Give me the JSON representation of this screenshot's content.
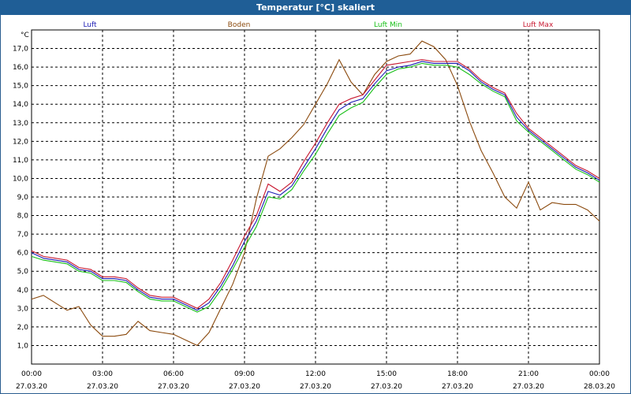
{
  "window": {
    "title": "Temperatur [°C] skaliert"
  },
  "chart_data": {
    "type": "line",
    "title": "Temperatur [°C] skaliert",
    "ylabel": "°C",
    "ylim": [
      0,
      18
    ],
    "xlim_hours": [
      0,
      24
    ],
    "grid": true,
    "legend_placement": "top",
    "y_ticks": [
      "1,0",
      "2,0",
      "3,0",
      "4,0",
      "5,0",
      "6,0",
      "7,0",
      "8,0",
      "9,0",
      "10,0",
      "11,0",
      "12,0",
      "13,0",
      "14,0",
      "15,0",
      "16,0",
      "17,0"
    ],
    "x_ticks": [
      {
        "time": "00:00",
        "date": "27.03.20"
      },
      {
        "time": "03:00",
        "date": "27.03.20"
      },
      {
        "time": "06:00",
        "date": "27.03.20"
      },
      {
        "time": "09:00",
        "date": "27.03.20"
      },
      {
        "time": "12:00",
        "date": "27.03.20"
      },
      {
        "time": "15:00",
        "date": "27.03.20"
      },
      {
        "time": "18:00",
        "date": "27.03.20"
      },
      {
        "time": "21:00",
        "date": "27.03.20"
      },
      {
        "time": "00:00",
        "date": "28.03.20"
      }
    ],
    "series": [
      {
        "name": "Luft",
        "color": "#1a1ab4",
        "points": [
          [
            "00:00",
            6.0
          ],
          [
            "00:30",
            5.7
          ],
          [
            "01:00",
            5.6
          ],
          [
            "01:30",
            5.5
          ],
          [
            "02:00",
            5.1
          ],
          [
            "02:30",
            5.0
          ],
          [
            "03:00",
            4.6
          ],
          [
            "03:30",
            4.6
          ],
          [
            "04:00",
            4.5
          ],
          [
            "04:30",
            4.0
          ],
          [
            "05:00",
            3.6
          ],
          [
            "05:30",
            3.5
          ],
          [
            "06:00",
            3.5
          ],
          [
            "06:30",
            3.2
          ],
          [
            "07:00",
            2.9
          ],
          [
            "07:30",
            3.3
          ],
          [
            "08:00",
            4.2
          ],
          [
            "08:30",
            5.3
          ],
          [
            "09:00",
            6.6
          ],
          [
            "09:30",
            7.7
          ],
          [
            "10:00",
            9.3
          ],
          [
            "10:30",
            9.1
          ],
          [
            "11:00",
            9.6
          ],
          [
            "11:30",
            10.6
          ],
          [
            "12:00",
            11.6
          ],
          [
            "12:30",
            12.7
          ],
          [
            "13:00",
            13.7
          ],
          [
            "13:30",
            14.1
          ],
          [
            "14:00",
            14.3
          ],
          [
            "14:30",
            15.1
          ],
          [
            "15:00",
            15.8
          ],
          [
            "15:30",
            16.0
          ],
          [
            "16:00",
            16.1
          ],
          [
            "16:30",
            16.3
          ],
          [
            "17:00",
            16.2
          ],
          [
            "17:30",
            16.2
          ],
          [
            "18:00",
            16.2
          ],
          [
            "18:30",
            15.8
          ],
          [
            "19:00",
            15.2
          ],
          [
            "19:30",
            14.8
          ],
          [
            "20:00",
            14.5
          ],
          [
            "20:30",
            13.3
          ],
          [
            "21:00",
            12.6
          ],
          [
            "21:30",
            12.1
          ],
          [
            "22:00",
            11.6
          ],
          [
            "22:30",
            11.1
          ],
          [
            "23:00",
            10.6
          ],
          [
            "23:30",
            10.3
          ],
          [
            "24:00",
            9.9
          ]
        ]
      },
      {
        "name": "Boden",
        "color": "#8b4a0e",
        "points": [
          [
            "00:00",
            3.5
          ],
          [
            "00:30",
            3.7
          ],
          [
            "01:00",
            3.3
          ],
          [
            "01:30",
            2.9
          ],
          [
            "02:00",
            3.1
          ],
          [
            "02:30",
            2.1
          ],
          [
            "03:00",
            1.5
          ],
          [
            "03:30",
            1.5
          ],
          [
            "04:00",
            1.6
          ],
          [
            "04:30",
            2.3
          ],
          [
            "05:00",
            1.8
          ],
          [
            "05:30",
            1.7
          ],
          [
            "06:00",
            1.6
          ],
          [
            "06:30",
            1.3
          ],
          [
            "07:00",
            1.0
          ],
          [
            "07:30",
            1.7
          ],
          [
            "08:00",
            3.0
          ],
          [
            "08:30",
            4.3
          ],
          [
            "09:00",
            6.0
          ],
          [
            "09:30",
            8.9
          ],
          [
            "10:00",
            11.2
          ],
          [
            "10:30",
            11.6
          ],
          [
            "11:00",
            12.2
          ],
          [
            "11:30",
            12.9
          ],
          [
            "12:00",
            14.0
          ],
          [
            "12:30",
            15.1
          ],
          [
            "13:00",
            16.4
          ],
          [
            "13:30",
            15.2
          ],
          [
            "14:00",
            14.5
          ],
          [
            "14:30",
            15.6
          ],
          [
            "15:00",
            16.3
          ],
          [
            "15:30",
            16.6
          ],
          [
            "16:00",
            16.7
          ],
          [
            "16:30",
            17.4
          ],
          [
            "17:00",
            17.1
          ],
          [
            "17:30",
            16.4
          ],
          [
            "18:00",
            15.0
          ],
          [
            "18:30",
            13.1
          ],
          [
            "19:00",
            11.5
          ],
          [
            "19:30",
            10.3
          ],
          [
            "20:00",
            9.0
          ],
          [
            "20:30",
            8.4
          ],
          [
            "21:00",
            9.8
          ],
          [
            "21:30",
            8.3
          ],
          [
            "22:00",
            8.7
          ],
          [
            "22:30",
            8.6
          ],
          [
            "23:00",
            8.6
          ],
          [
            "23:30",
            8.3
          ],
          [
            "24:00",
            7.7
          ]
        ]
      },
      {
        "name": "Luft Min",
        "color": "#18c018",
        "points": [
          [
            "00:00",
            5.8
          ],
          [
            "00:30",
            5.6
          ],
          [
            "01:00",
            5.5
          ],
          [
            "01:30",
            5.4
          ],
          [
            "02:00",
            5.0
          ],
          [
            "02:30",
            4.9
          ],
          [
            "03:00",
            4.5
          ],
          [
            "03:30",
            4.5
          ],
          [
            "04:00",
            4.4
          ],
          [
            "04:30",
            3.9
          ],
          [
            "05:00",
            3.5
          ],
          [
            "05:30",
            3.4
          ],
          [
            "06:00",
            3.4
          ],
          [
            "06:30",
            3.1
          ],
          [
            "07:00",
            2.8
          ],
          [
            "07:30",
            3.1
          ],
          [
            "08:00",
            4.0
          ],
          [
            "08:30",
            5.1
          ],
          [
            "09:00",
            6.3
          ],
          [
            "09:30",
            7.4
          ],
          [
            "10:00",
            9.0
          ],
          [
            "10:30",
            8.9
          ],
          [
            "11:00",
            9.4
          ],
          [
            "11:30",
            10.4
          ],
          [
            "12:00",
            11.3
          ],
          [
            "12:30",
            12.4
          ],
          [
            "13:00",
            13.4
          ],
          [
            "13:30",
            13.8
          ],
          [
            "14:00",
            14.1
          ],
          [
            "14:30",
            14.9
          ],
          [
            "15:00",
            15.6
          ],
          [
            "15:30",
            15.9
          ],
          [
            "16:00",
            16.0
          ],
          [
            "16:30",
            16.2
          ],
          [
            "17:00",
            16.1
          ],
          [
            "17:30",
            16.1
          ],
          [
            "18:00",
            16.0
          ],
          [
            "18:30",
            15.6
          ],
          [
            "19:00",
            15.1
          ],
          [
            "19:30",
            14.7
          ],
          [
            "20:00",
            14.4
          ],
          [
            "20:30",
            13.1
          ],
          [
            "21:00",
            12.5
          ],
          [
            "21:30",
            12.0
          ],
          [
            "22:00",
            11.5
          ],
          [
            "22:30",
            11.0
          ],
          [
            "23:00",
            10.5
          ],
          [
            "23:30",
            10.2
          ],
          [
            "24:00",
            9.8
          ]
        ]
      },
      {
        "name": "Luft Max",
        "color": "#c81830",
        "points": [
          [
            "00:00",
            6.1
          ],
          [
            "00:30",
            5.8
          ],
          [
            "01:00",
            5.7
          ],
          [
            "01:30",
            5.6
          ],
          [
            "02:00",
            5.2
          ],
          [
            "02:30",
            5.1
          ],
          [
            "03:00",
            4.7
          ],
          [
            "03:30",
            4.7
          ],
          [
            "04:00",
            4.6
          ],
          [
            "04:30",
            4.1
          ],
          [
            "05:00",
            3.7
          ],
          [
            "05:30",
            3.6
          ],
          [
            "06:00",
            3.6
          ],
          [
            "06:30",
            3.3
          ],
          [
            "07:00",
            3.0
          ],
          [
            "07:30",
            3.5
          ],
          [
            "08:00",
            4.4
          ],
          [
            "08:30",
            5.6
          ],
          [
            "09:00",
            6.9
          ],
          [
            "09:30",
            8.0
          ],
          [
            "10:00",
            9.7
          ],
          [
            "10:30",
            9.3
          ],
          [
            "11:00",
            9.8
          ],
          [
            "11:30",
            10.9
          ],
          [
            "12:00",
            11.9
          ],
          [
            "12:30",
            13.0
          ],
          [
            "13:00",
            14.0
          ],
          [
            "13:30",
            14.3
          ],
          [
            "14:00",
            14.5
          ],
          [
            "14:30",
            15.3
          ],
          [
            "15:00",
            16.1
          ],
          [
            "15:30",
            16.2
          ],
          [
            "16:00",
            16.3
          ],
          [
            "16:30",
            16.4
          ],
          [
            "17:00",
            16.3
          ],
          [
            "17:30",
            16.3
          ],
          [
            "18:00",
            16.3
          ],
          [
            "18:30",
            15.9
          ],
          [
            "19:00",
            15.3
          ],
          [
            "19:30",
            14.9
          ],
          [
            "20:00",
            14.6
          ],
          [
            "20:30",
            13.5
          ],
          [
            "21:00",
            12.7
          ],
          [
            "21:30",
            12.2
          ],
          [
            "22:00",
            11.7
          ],
          [
            "22:30",
            11.2
          ],
          [
            "23:00",
            10.7
          ],
          [
            "23:30",
            10.4
          ],
          [
            "24:00",
            10.0
          ]
        ]
      }
    ]
  }
}
